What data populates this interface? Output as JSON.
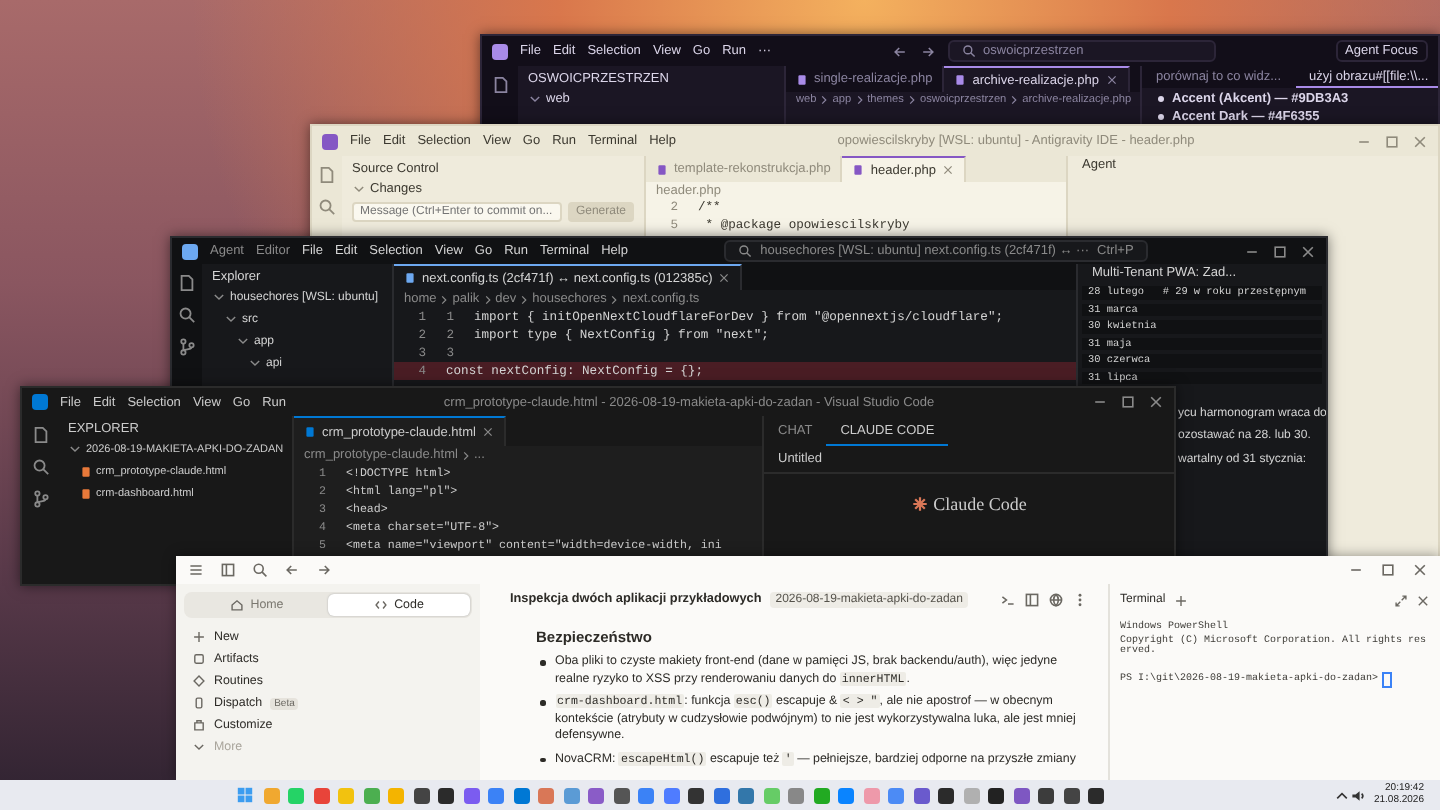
{
  "windows": [
    {
      "kind": "editor",
      "menu": [
        "File",
        "Edit",
        "Selection",
        "View",
        "Go",
        "Run",
        "···"
      ],
      "search": "oswoicprzestrzen",
      "title_buttons": [
        "Agent Focus"
      ],
      "sidebar": {
        "title": "OSWOICPRZESTRZEN",
        "tree": [
          {
            "label": "web",
            "expanded": true
          }
        ]
      },
      "tabs": [
        {
          "label": "single-realizacje.php",
          "selected": false
        },
        {
          "label": "archive-realizacje.php",
          "selected": true
        }
      ],
      "breadcrumb": [
        "web",
        "app",
        "themes",
        "oswoicprzestrzen",
        "archive-realizacje.php"
      ],
      "panel": {
        "tabs": [
          {
            "label": "porównaj to co widz...",
            "selected": false
          },
          {
            "label": "użyj obrazu#[[file:\\\\...",
            "selected": true
          }
        ],
        "lines": [
          {
            "kind": "bullet",
            "text": "Accent (Akcent) — #9DB3A3"
          },
          {
            "kind": "bullet",
            "text": "Accent Dark — #4F6355"
          }
        ]
      }
    },
    {
      "kind": "editor",
      "menu": [
        "File",
        "Edit",
        "Selection",
        "View",
        "Go",
        "Run",
        "Terminal",
        "Help"
      ],
      "title": "opowiescilskryby [WSL: ubuntu] - Antigravity IDE - header.php",
      "sidebar": {
        "title": "Source Control",
        "tree": [
          {
            "label": "Changes",
            "expanded": true
          }
        ],
        "commit": {
          "placeholder": "Message (Ctrl+Enter to commit on...",
          "button": "Generate"
        }
      },
      "tabs": [
        {
          "label": "template-rekonstrukcja.php",
          "selected": false
        },
        {
          "label": "header.php",
          "selected": true
        }
      ],
      "breadcrumb": [
        "header.php"
      ],
      "code": [
        {
          "kind": "context",
          "numbers": [
            "2"
          ],
          "text": "/**"
        },
        {
          "kind": "context",
          "numbers": [
            "5"
          ],
          "text": " * @package opowiescilskryby"
        }
      ],
      "panel": {
        "title": "Agent"
      }
    },
    {
      "kind": "editor",
      "modes": [
        "Agent",
        "Editor"
      ],
      "menu": [
        "File",
        "Edit",
        "Selection",
        "View",
        "Go",
        "Run",
        "Terminal",
        "Help"
      ],
      "search": "housechores [WSL: ubuntu]   next.config.ts (2cf471f) ↔ ···",
      "shortcut": "Ctrl+P",
      "sidebar": {
        "title": "Explorer",
        "tree": [
          {
            "label": "housechores [WSL: ubuntu]",
            "expanded": true,
            "children": [
              {
                "label": "src",
                "expanded": true,
                "children": [
                  {
                    "label": "app",
                    "expanded": true,
                    "children": [
                      {
                        "label": "api",
                        "expanded": true
                      }
                    ]
                  }
                ]
              }
            ]
          }
        ]
      },
      "tabs": [
        {
          "label": "next.config.ts (2cf471f) ↔ next.config.ts (012385c)",
          "selected": true
        }
      ],
      "breadcrumb": [
        "home",
        "palik",
        "dev",
        "housechores",
        "next.config.ts"
      ],
      "code": [
        {
          "kind": "context",
          "numbers": [
            "1",
            "1"
          ],
          "text": "import { initOpenNextCloudflareForDev } from \"@opennextjs/cloudflare\";"
        },
        {
          "kind": "context",
          "numbers": [
            "2",
            "2"
          ],
          "text": "import type { NextConfig } from \"next\";"
        },
        {
          "kind": "context",
          "numbers": [
            "3",
            "3"
          ]
        },
        {
          "kind": "removed",
          "numbers": [
            "4"
          ],
          "text": "const nextConfig: NextConfig = {};"
        }
      ],
      "panel": {
        "title": "Multi-Tenant PWA: Zad...",
        "lines": [
          {
            "kind": "code",
            "text": "28 lutego   # 29 w roku przestępnym"
          },
          {
            "kind": "code",
            "text": "31 marca"
          },
          {
            "kind": "code",
            "text": "30 kwietnia"
          },
          {
            "kind": "code",
            "text": "31 maja"
          },
          {
            "kind": "code",
            "text": "30 czerwca"
          },
          {
            "kind": "code",
            "text": "31 lipca"
          },
          {
            "kind": "text",
            "text": "ycu harmonogram wraca do"
          },
          {
            "kind": "text",
            "text": "ozostawać na 28. lub 30."
          },
          {
            "kind": "text",
            "text": "wartalny od 31 stycznia:"
          }
        ]
      }
    },
    {
      "kind": "editor",
      "menu": [
        "File",
        "Edit",
        "Selection",
        "View",
        "Go",
        "Run"
      ],
      "title": "crm_prototype-claude.html - 2026-08-19-makieta-apki-do-zadan - Visual Studio Code",
      "sidebar": {
        "title": "EXPLORER",
        "tree": [
          {
            "label": "2026-08-19-MAKIETA-APKI-DO-ZADAN",
            "expanded": true,
            "children": [
              {
                "label": "crm_prototype-claude.html"
              },
              {
                "label": "crm-dashboard.html"
              }
            ]
          }
        ]
      },
      "tabs": [
        {
          "label": "crm_prototype-claude.html",
          "selected": true
        }
      ],
      "breadcrumb": [
        "crm_prototype-claude.html",
        "..."
      ],
      "code": [
        {
          "kind": "context",
          "numbers": [
            "1"
          ],
          "text": "<!DOCTYPE html>"
        },
        {
          "kind": "context",
          "numbers": [
            "2"
          ],
          "text": "<html lang=\"pl\">"
        },
        {
          "kind": "context",
          "numbers": [
            "3"
          ],
          "text": "<head>"
        },
        {
          "kind": "context",
          "numbers": [
            "4"
          ],
          "text": "<meta charset=\"UTF-8\">"
        },
        {
          "kind": "context",
          "numbers": [
            "5"
          ],
          "text": "<meta name=\"viewport\" content=\"width=device-width, ini"
        }
      ],
      "panel": {
        "tabs": [
          {
            "label": "CHAT",
            "selected": false
          },
          {
            "label": "CLAUDE CODE",
            "selected": true
          }
        ],
        "title": "Untitled",
        "logo": "Claude Code"
      }
    },
    {
      "kind": "chat_app",
      "sidebar": {
        "toggle": [
          {
            "label": "Home",
            "selected": false
          },
          {
            "label": "Code",
            "selected": true
          }
        ],
        "items": [
          {
            "label": "New",
            "disabled": false
          },
          {
            "label": "Artifacts",
            "disabled": false
          },
          {
            "label": "Routines",
            "disabled": false
          },
          {
            "label": "Dispatch",
            "badge": "Beta",
            "disabled": false
          },
          {
            "label": "Customize",
            "disabled": false
          },
          {
            "label": "More",
            "disabled": true
          }
        ]
      },
      "conversation": {
        "title": "Inspekcja dwóch aplikacji przykładowych",
        "folder": "2026-08-19-makieta-apki-do-zadan",
        "heading": "Bezpieczeństwo",
        "bullets": [
          [
            {
              "kind": "text",
              "text": "Oba pliki to czyste makiety front-end (dane w pamięci JS, brak backendu/auth), więc jedyne realne ryzyko to XSS przy renderowaniu danych do "
            },
            {
              "kind": "code",
              "text": "innerHTML"
            },
            {
              "kind": "text",
              "text": "."
            }
          ],
          [
            {
              "kind": "code",
              "text": "crm-dashboard.html"
            },
            {
              "kind": "text",
              "text": ": funkcja "
            },
            {
              "kind": "code",
              "text": "esc()"
            },
            {
              "kind": "text",
              "text": " escapuje & "
            },
            {
              "kind": "code",
              "text": "< > \""
            },
            {
              "kind": "text",
              "text": ", ale nie apostrof — w obecnym kontekście (atrybuty w cudzysłowie podwójnym) to nie jest wykorzystywalna luka, ale jest mniej defensywne."
            }
          ],
          [
            {
              "kind": "text",
              "text": "NovaCRM: "
            },
            {
              "kind": "code",
              "text": "escapeHtml()"
            },
            {
              "kind": "text",
              "text": " escapuje też "
            },
            {
              "kind": "code",
              "text": "'"
            },
            {
              "kind": "text",
              "text": " — pełniejsze, bardziej odporne na przyszłe zmiany"
            }
          ]
        ]
      },
      "terminal": {
        "title": "Terminal",
        "lines": [
          "Windows PowerShell",
          "Copyright (C) Microsoft Corporation. All rights reserved."
        ],
        "prompt": "PS I:\\git\\2026-08-19-makieta-apki-do-zadan>"
      }
    }
  ],
  "taskbar": {
    "time": "20:19:42",
    "date": "21.08.2026"
  }
}
